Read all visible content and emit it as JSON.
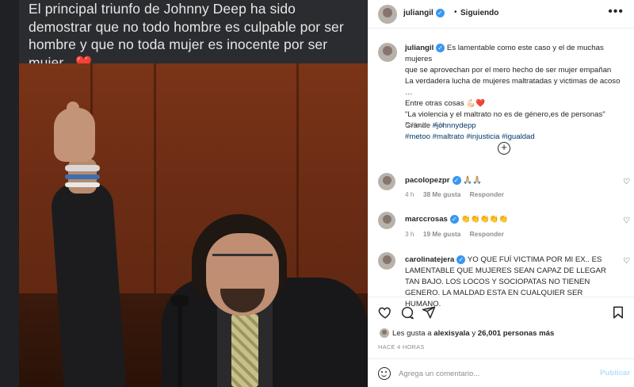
{
  "media": {
    "caption": "El principal triunfo de Johnny Deep ha sido demostrar que no todo hombre es culpable por ser hombre y que no toda mujer es inocente por ser mujer..",
    "caption_emoji": "❤️"
  },
  "header": {
    "username": "juliangil",
    "separator": "•",
    "follow_state": "Siguiendo",
    "more_icon": "more-horizontal-icon"
  },
  "post": {
    "username": "juliangil",
    "caption_lines": [
      "Es lamentable como este caso y el de muchas mujeres",
      "que se aprovechan por el mero hecho de ser mujer empañan",
      "La verdadera lucha de mujeres maltratadas y victimas de acoso …",
      "Entre otras cosas 💪🏻❤️",
      "\"La violencia y el maltrato no es de género,es de personas\"",
      "Grande "
    ],
    "tag_inline": "#johnnydepp",
    "hashtags": "#metoo #maltrato #injusticia #igualdad",
    "edited": "Editado · 4 h"
  },
  "comments": [
    {
      "username": "pacolopezpr",
      "text": "🙏🏼🙏🏼",
      "time": "4 h",
      "likes": "38 Me gusta",
      "reply": "Responder"
    },
    {
      "username": "marccrosas",
      "text": "👏👏👏👏👏",
      "time": "3 h",
      "likes": "19 Me gusta",
      "reply": "Responder"
    },
    {
      "username": "carolinatejera",
      "text": "YO QUE FUÍ VICTIMA POR MI EX.. ES LAMENTABLE QUE MUJERES SEAN CAPAZ DE LLEGAR TAN BAJO. LOS LOCOS Y SOCIOPATAS NO TIENEN GENERO. LA MALDAD ESTA EN CUALQUIER SER HUMANO."
    }
  ],
  "likes": {
    "prefix": "Les gusta a",
    "user": "alexisyala",
    "joiner": "y",
    "count": "26,001 personas más"
  },
  "timestamp": "HACE 4 HORAS",
  "comment_box": {
    "placeholder": "Agrega un comentario...",
    "post_label": "Publicar"
  },
  "colors": {
    "link": "#00376b",
    "muted": "#8e8e8e",
    "verified": "#3897f0",
    "post_disabled": "#b2dffc"
  }
}
